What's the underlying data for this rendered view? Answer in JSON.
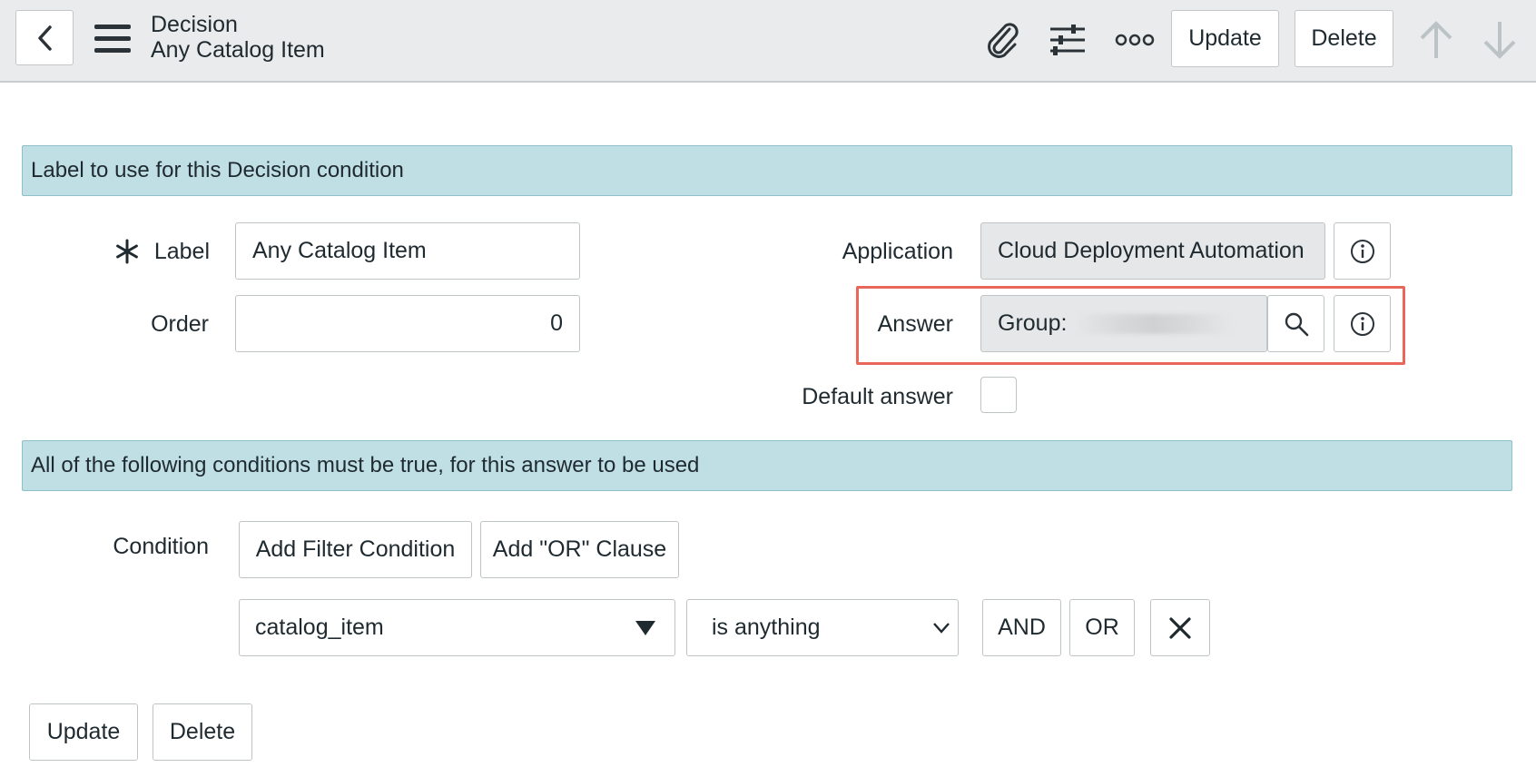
{
  "header": {
    "title_line1": "Decision",
    "title_line2": "Any Catalog Item",
    "update_label": "Update",
    "delete_label": "Delete",
    "icons": [
      "back-icon",
      "menu-icon",
      "paperclip-icon",
      "sliders-icon",
      "more-icon",
      "arrow-up-icon",
      "arrow-down-icon"
    ]
  },
  "section1": {
    "text": "Label to use for this Decision condition"
  },
  "form": {
    "label_label": "Label",
    "required_marker": "∗",
    "label_value": "Any Catalog Item",
    "order_label": "Order",
    "order_value": "0",
    "application_label": "Application",
    "application_value": "Cloud Deployment Automation",
    "answer_label": "Answer",
    "answer_value_prefix": "Group:",
    "default_answer_label": "Default answer",
    "default_answer_checked": false
  },
  "section2": {
    "text": "All of the following conditions must be true, for this answer to be used"
  },
  "conditions": {
    "condition_label": "Condition",
    "add_filter_label": "Add Filter Condition",
    "add_or_label": "Add \"OR\" Clause",
    "field_value": "catalog_item",
    "operator_value": "is anything",
    "and_label": "AND",
    "or_label": "OR"
  },
  "footer": {
    "update_label": "Update",
    "delete_label": "Delete"
  },
  "colors": {
    "section_bg": "#bfdfe5",
    "highlight_border": "#e8665a",
    "header_bg": "#eaebec"
  }
}
